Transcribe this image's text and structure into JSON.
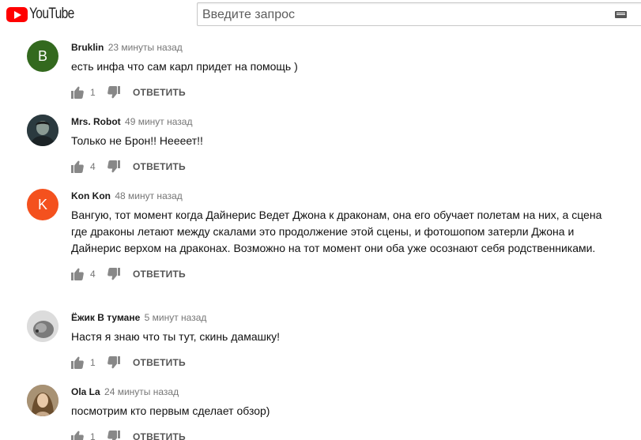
{
  "header": {
    "logo_text": "YouTube",
    "search_placeholder": "Введите запрос"
  },
  "reply_label": "ОТВЕТИТЬ",
  "comments": [
    {
      "author": "Bruklin",
      "time": "23 минуты назад",
      "text": "есть инфа что сам карл придет на помощь )",
      "likes": "1",
      "avatar_letter": "B",
      "avatar_color": "#33691e"
    },
    {
      "author": "Mrs. Robot",
      "time": "49 минут назад",
      "text": "Только не Брон!! Неееет!!",
      "likes": "4",
      "avatar_letter": "",
      "avatar_color": "#37474f"
    },
    {
      "author": "Kon Kon",
      "time": "48 минут назад",
      "text": "Вангую, тот момент когда Дайнерис Ведет Джона к драконам, она его обучает полетам на них, а сцена где драконы летают между скалами это продолжение этой сцены, и фотошопом затерли Джона и Дайнерис верхом на драконах. Возможно на тот момент они оба уже осознают себя родственниками.",
      "likes": "4",
      "avatar_letter": "K",
      "avatar_color": "#f4511e"
    },
    {
      "author": "Ёжик В тумане",
      "time": "5 минут назад",
      "text": "Настя я знаю что ты тут, скинь дамашку!",
      "likes": "1",
      "avatar_letter": "",
      "avatar_color": "#9e9e9e"
    },
    {
      "author": "Ola La",
      "time": "24 минуты назад",
      "text": "посмотрим кто первым сделает обзор)",
      "likes": "1",
      "avatar_letter": "",
      "avatar_color": "#8d6e63"
    }
  ]
}
